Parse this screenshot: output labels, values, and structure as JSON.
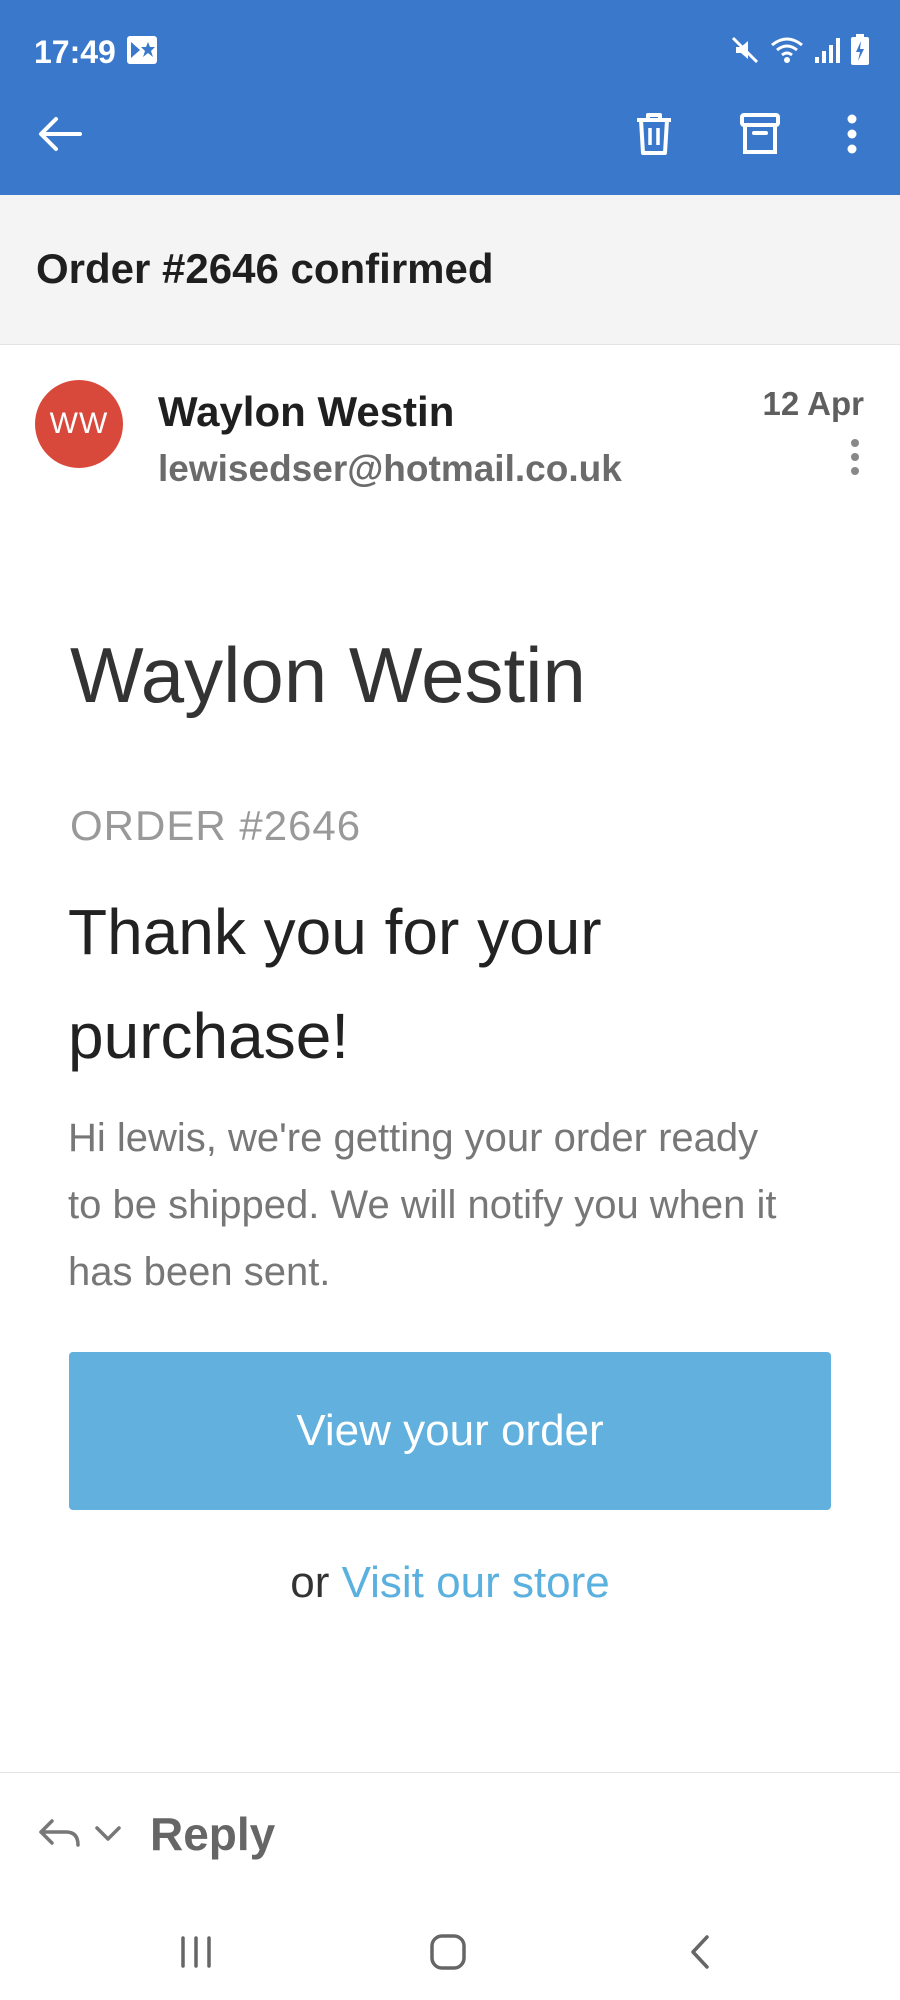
{
  "status_bar": {
    "time": "17:49"
  },
  "toolbar": {
    "back_icon": "arrow-left-icon",
    "delete_icon": "trash-icon",
    "archive_icon": "archive-icon",
    "more_icon": "vertical-dots-icon"
  },
  "email": {
    "subject": "Order #2646 confirmed",
    "sender": {
      "initials": "WW",
      "name": "Waylon Westin",
      "email": "lewisedser@hotmail.co.uk",
      "avatar_color": "#d8493c"
    },
    "date": "12 Apr",
    "body": {
      "shop_name": "Waylon Westin",
      "order_label": "ORDER #2646",
      "heading": "Thank you for your purchase!",
      "text": "Hi lewis, we're getting your order ready to be shipped. We will notify you when it has been sent.",
      "cta_label": "View your order",
      "alt_prefix": "or",
      "alt_link": "Visit our store"
    }
  },
  "reply_bar": {
    "label": "Reply"
  },
  "colors": {
    "appbar": "#3a78cc",
    "cta": "#61b0dd",
    "link": "#5ab0de"
  }
}
